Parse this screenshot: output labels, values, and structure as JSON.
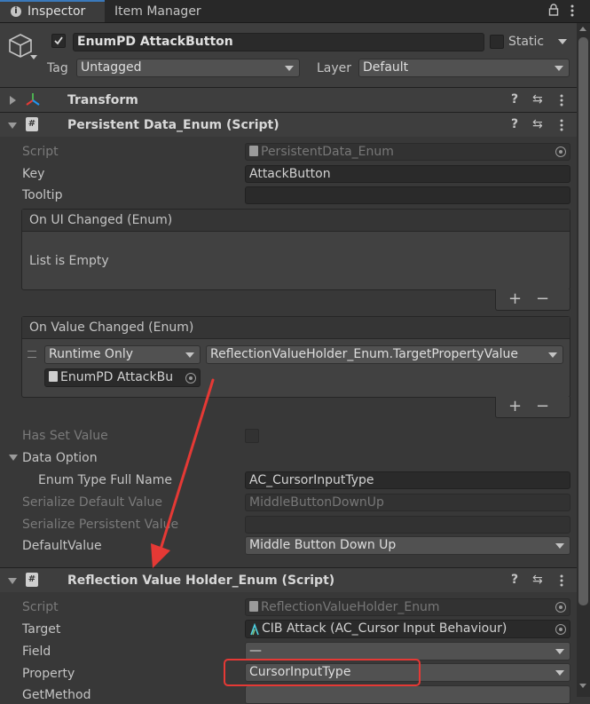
{
  "tabs": [
    {
      "label": "Inspector",
      "icon": "info-icon"
    },
    {
      "label": "Item Manager"
    }
  ],
  "object": {
    "name": "EnumPD AttackButton",
    "static_label": "Static",
    "tag_label": "Tag",
    "tag_value": "Untagged",
    "layer_label": "Layer",
    "layer_value": "Default"
  },
  "transform": {
    "title": "Transform"
  },
  "persistent": {
    "title": "Persistent Data_Enum (Script)",
    "script_label": "Script",
    "script_value": "PersistentData_Enum",
    "key_label": "Key",
    "key_value": "AttackButton",
    "tooltip_label": "Tooltip",
    "tooltip_value": "",
    "ui_changed_title": "On UI Changed (Enum)",
    "list_empty": "List is Empty",
    "value_changed_title": "On Value Changed (Enum)",
    "runtime_value": "Runtime Only",
    "function_value": "ReflectionValueHolder_Enum.TargetPropertyValue",
    "object_value": "EnumPD AttackBu",
    "plus": "+",
    "minus": "−",
    "has_set_label": "Has Set Value",
    "data_option_label": "Data Option",
    "enum_type_label": "Enum Type Full Name",
    "enum_type_value": "AC_CursorInputType",
    "ser_default_label": "Serialize Default Value",
    "ser_default_value": "MiddleButtonDownUp",
    "ser_persistent_label": "Serialize Persistent Value",
    "ser_persistent_value": "",
    "default_value_label": "DefaultValue",
    "default_value_value": "Middle Button Down Up"
  },
  "reflection": {
    "title": "Reflection Value Holder_Enum (Script)",
    "script_label": "Script",
    "script_value": "ReflectionValueHolder_Enum",
    "target_label": "Target",
    "target_value": "CIB Attack (AC_Cursor Input Behaviour)",
    "field_label": "Field",
    "field_value": "—",
    "property_label": "Property",
    "property_value": "CursorInputType",
    "getmethod_label": "GetMethod"
  },
  "colors": {
    "annotation": "#e53935",
    "background": "#383838"
  }
}
